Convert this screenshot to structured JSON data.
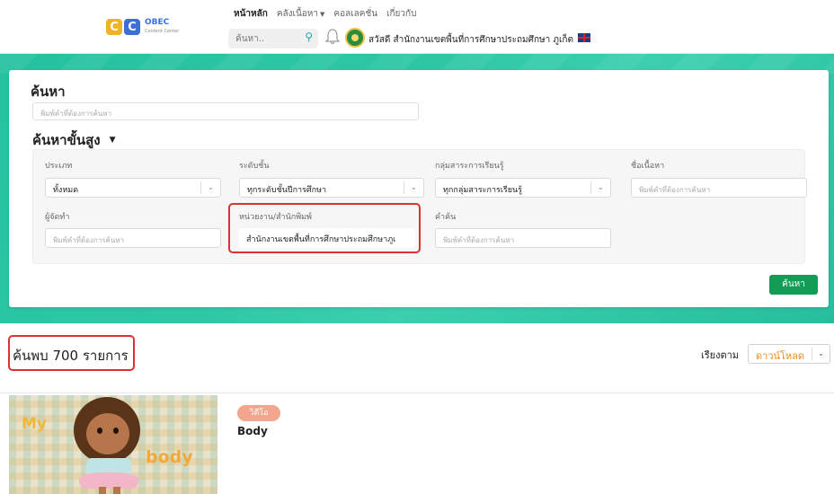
{
  "brand": {
    "logo_text": "OBEC",
    "logo_sub": "Content Center",
    "colors": {
      "teal": "#2dc7a4",
      "primary_green": "#139c55",
      "highlight_red": "#d9322f",
      "sort_orange": "#f08a1a"
    }
  },
  "nav": {
    "items": [
      {
        "label": "หน้าหลัก",
        "active": true
      },
      {
        "label": "คลังเนื้อหา",
        "has_dropdown": true
      },
      {
        "label": "คอลเลคชั่น"
      },
      {
        "label": "เกี่ยวกับ"
      }
    ],
    "search_placeholder": "ค้นหา..",
    "greeting": "สวัสดี สำนักงานเขตพื้นที่การศึกษาประถมศึกษา ภูเก็ต",
    "icons": [
      "search-icon",
      "bell-icon",
      "seal-icon",
      "uk-flag-icon"
    ]
  },
  "search": {
    "title": "ค้นหา",
    "keyword_placeholder": "พิมพ์คำที่ต้องการค้นหา",
    "advanced_title": "ค้นหาขั้นสูง",
    "fields": {
      "type": {
        "label": "ประเภท",
        "value": "ทั้งหมด"
      },
      "level": {
        "label": "ระดับชั้น",
        "value": "ทุกระดับชั้นปีการศึกษา"
      },
      "subject": {
        "label": "กลุ่มสาระการเรียนรู้",
        "value": "ทุกกลุ่มสาระการเรียนรู้"
      },
      "title": {
        "label": "ชื่อเนื้อหา",
        "placeholder": "พิมพ์คำที่ต้องการค้นหา"
      },
      "author": {
        "label": "ผู้จัดทำ",
        "placeholder": "พิมพ์คำที่ต้องการค้นหา"
      },
      "publisher": {
        "label": "หน่วยงาน/สำนักพิมพ์",
        "value": "สำนักงานเขตพื้นที่การศึกษาประถมศึกษาภูเ"
      },
      "keyword": {
        "label": "คำค้น",
        "placeholder": "พิมพ์คำที่ต้องการค้นหา"
      }
    },
    "button_label": "ค้นหา"
  },
  "results": {
    "count_text": "ค้นพบ 700 รายการ",
    "sort_label": "เรียงตาม",
    "sort_value": "ดาวน์โหลด",
    "items": [
      {
        "tag": "วิดีโอ",
        "title": "Body",
        "thumb_text_1": "My",
        "thumb_text_2": "body"
      }
    ]
  }
}
